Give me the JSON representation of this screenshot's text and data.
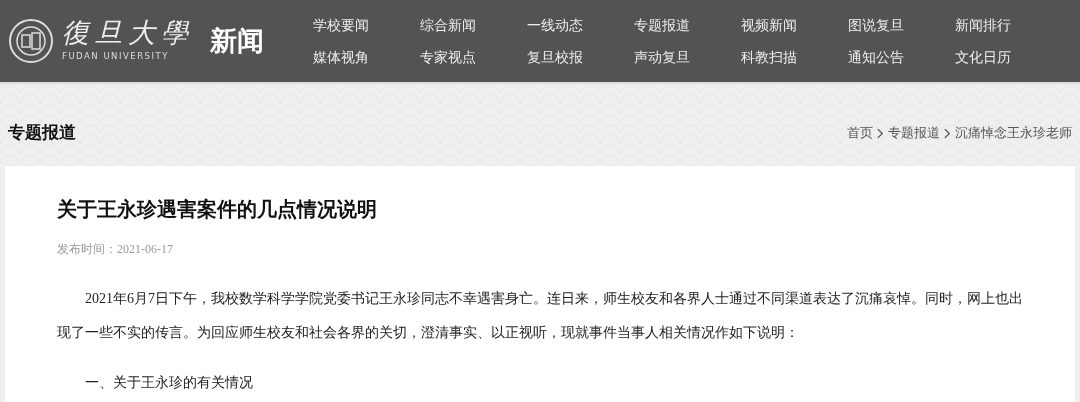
{
  "header": {
    "logo_calligraphy": "復旦大學",
    "logo_english": "FUDAN UNIVERSITY",
    "site_name": "新闻",
    "nav": [
      [
        "学校要闻",
        "综合新闻",
        "一线动态",
        "专题报道",
        "视频新闻",
        "图说复旦",
        "新闻排行"
      ],
      [
        "媒体视角",
        "专家视点",
        "复旦校报",
        "声动复旦",
        "科教扫描",
        "通知公告",
        "文化日历"
      ]
    ]
  },
  "section": {
    "title": "专题报道",
    "breadcrumb": [
      "首页",
      "专题报道",
      "沉痛悼念王永珍老师"
    ]
  },
  "article": {
    "title": "关于王永珍遇害案件的几点情况说明",
    "publish_time": "发布时间：2021-06-17",
    "paragraphs": [
      "2021年6月7日下午，我校数学科学学院党委书记王永珍同志不幸遇害身亡。连日来，师生校友和各界人士通过不同渠道表达了沉痛哀悼。同时，网上也出现了一些不实的传言。为回应师生校友和社会各界的关切，澄清事实、以正视听，现就事件当事人相关情况作如下说明：",
      "一、关于王永珍的有关情况"
    ]
  }
}
